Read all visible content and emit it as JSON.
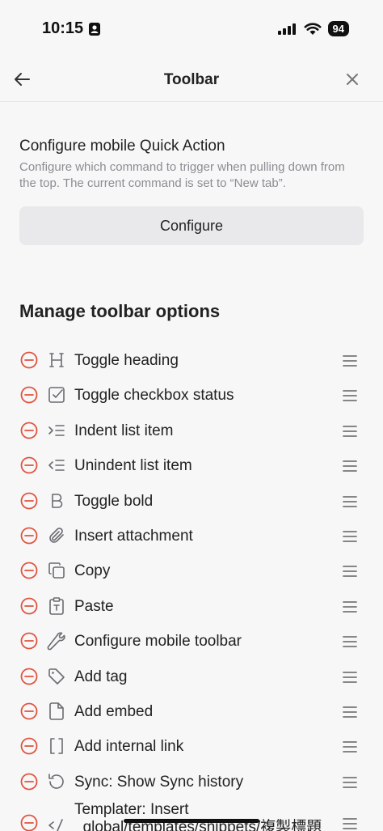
{
  "status": {
    "time": "10:15",
    "battery": "94"
  },
  "header": {
    "title": "Toolbar"
  },
  "quick_action": {
    "title": "Configure mobile Quick Action",
    "description": "Configure which command to trigger when pulling down from the top. The current command is set to “New tab”.",
    "button": "Configure"
  },
  "manage": {
    "title": "Manage toolbar options"
  },
  "items": [
    {
      "label": "Toggle heading",
      "icon": "heading-icon"
    },
    {
      "label": "Toggle checkbox status",
      "icon": "checkbox-icon"
    },
    {
      "label": "Indent list item",
      "icon": "indent-icon"
    },
    {
      "label": "Unindent list item",
      "icon": "unindent-icon"
    },
    {
      "label": "Toggle bold",
      "icon": "bold-icon"
    },
    {
      "label": "Insert attachment",
      "icon": "paperclip-icon"
    },
    {
      "label": "Copy",
      "icon": "copy-icon"
    },
    {
      "label": "Paste",
      "icon": "clipboard-icon"
    },
    {
      "label": "Configure mobile toolbar",
      "icon": "wrench-icon"
    },
    {
      "label": "Add tag",
      "icon": "tag-icon"
    },
    {
      "label": "Add embed",
      "icon": "file-icon"
    },
    {
      "label": "Add internal link",
      "icon": "brackets-icon"
    },
    {
      "label": "Sync: Show Sync history",
      "icon": "history-icon"
    },
    {
      "label": "Templater: Insert",
      "label2": "_global/templates/snippets/複製標題",
      "icon": "percent-icon"
    }
  ],
  "colors": {
    "remove": "#e0533e",
    "icon": "#6b6b70",
    "text": "#222222"
  }
}
